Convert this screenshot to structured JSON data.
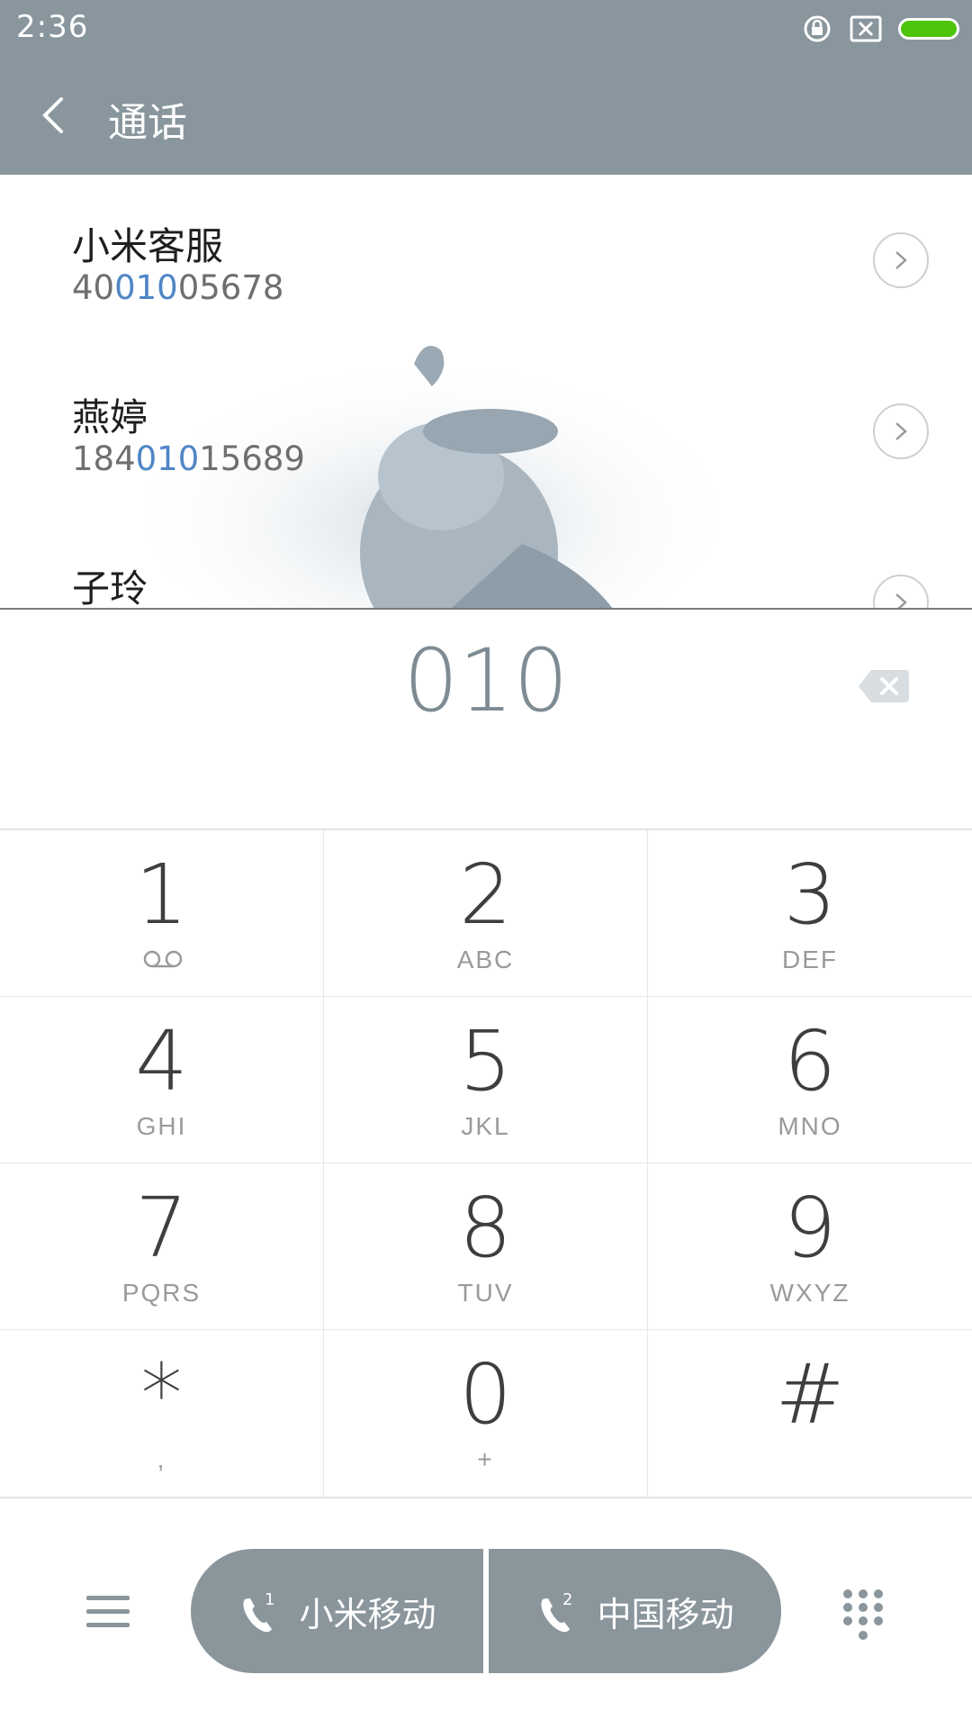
{
  "status_bar": {
    "time": "2:36",
    "icons": [
      "rotation-lock-icon",
      "no-sim-icon",
      "battery-icon"
    ],
    "battery_color": "#4cc40a"
  },
  "header": {
    "title": "通话",
    "background": "#89969d"
  },
  "contacts": [
    {
      "name": "小米客服",
      "number_pre": "40",
      "number_match": "010",
      "number_post": "05678"
    },
    {
      "name": "燕婷",
      "number_pre": "184",
      "number_match": "010",
      "number_post": "15689"
    },
    {
      "name": "子玲",
      "number_pre": "",
      "number_match": "",
      "number_post": ""
    }
  ],
  "highlight_color": "#4f86c6",
  "dialed_number": "010",
  "keypad": [
    {
      "digit": "1",
      "letters": "",
      "icon": "voicemail-icon"
    },
    {
      "digit": "2",
      "letters": "ABC"
    },
    {
      "digit": "3",
      "letters": "DEF"
    },
    {
      "digit": "4",
      "letters": "GHI"
    },
    {
      "digit": "5",
      "letters": "JKL"
    },
    {
      "digit": "6",
      "letters": "MNO"
    },
    {
      "digit": "7",
      "letters": "PQRS"
    },
    {
      "digit": "8",
      "letters": "TUV"
    },
    {
      "digit": "9",
      "letters": "WXYZ"
    },
    {
      "digit": "*",
      "letters": ","
    },
    {
      "digit": "0",
      "letters": "+"
    },
    {
      "digit": "#",
      "letters": ""
    }
  ],
  "bottom_bar": {
    "sim1_label": "小米移动",
    "sim2_label": "中国移动",
    "sim1_index": "1",
    "sim2_index": "2",
    "button_color": "#8a959c"
  }
}
